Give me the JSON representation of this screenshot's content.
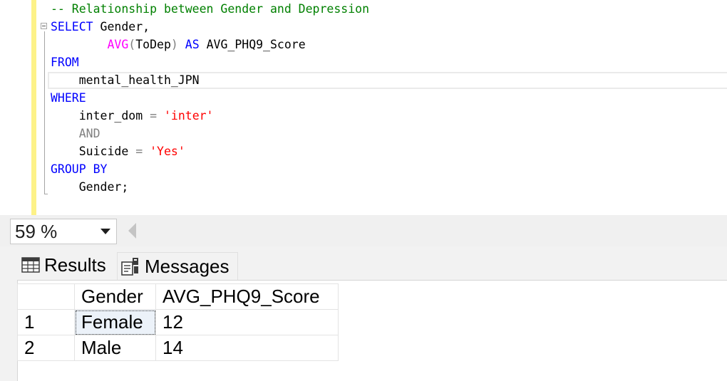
{
  "editor": {
    "lines": [
      [
        {
          "t": "-- Relationship between Gender and Depression",
          "c": "cm"
        }
      ],
      [
        {
          "t": "SELECT",
          "c": "kw"
        },
        {
          "t": " Gender,",
          "c": ""
        }
      ],
      [
        {
          "t": "        ",
          "c": ""
        },
        {
          "t": "AVG",
          "c": "fn"
        },
        {
          "t": "(",
          "c": "op"
        },
        {
          "t": "ToDep",
          "c": ""
        },
        {
          "t": ")",
          "c": "op"
        },
        {
          "t": " ",
          "c": ""
        },
        {
          "t": "AS",
          "c": "kw"
        },
        {
          "t": " AVG_PHQ9_Score",
          "c": ""
        }
      ],
      [
        {
          "t": "FROM",
          "c": "kw"
        }
      ],
      [
        {
          "t": "    mental_health_JPN",
          "c": ""
        }
      ],
      [
        {
          "t": "WHERE",
          "c": "kw"
        }
      ],
      [
        {
          "t": "    inter_dom ",
          "c": ""
        },
        {
          "t": "=",
          "c": "op"
        },
        {
          "t": " ",
          "c": ""
        },
        {
          "t": "'inter'",
          "c": "str"
        }
      ],
      [
        {
          "t": "    ",
          "c": ""
        },
        {
          "t": "AND",
          "c": "op"
        }
      ],
      [
        {
          "t": "    Suicide ",
          "c": ""
        },
        {
          "t": "=",
          "c": "op"
        },
        {
          "t": " ",
          "c": ""
        },
        {
          "t": "'Yes'",
          "c": "str"
        }
      ],
      [
        {
          "t": "GROUP BY",
          "c": "kw"
        }
      ],
      [
        {
          "t": "    Gender;",
          "c": ""
        }
      ]
    ]
  },
  "zoom": {
    "value": "59 %"
  },
  "tabs": {
    "results": "Results",
    "messages": "Messages"
  },
  "results": {
    "headers": [
      "",
      "Gender",
      "AVG_PHQ9_Score"
    ],
    "rows": [
      [
        "1",
        "Female",
        "12"
      ],
      [
        "2",
        "Male",
        "14"
      ]
    ]
  },
  "colors": {
    "keyword": "#0000ff",
    "function": "#ff00ff",
    "comment": "#008000",
    "string": "#ff0000",
    "operator": "#808080",
    "change_bar": "#fdf288"
  }
}
